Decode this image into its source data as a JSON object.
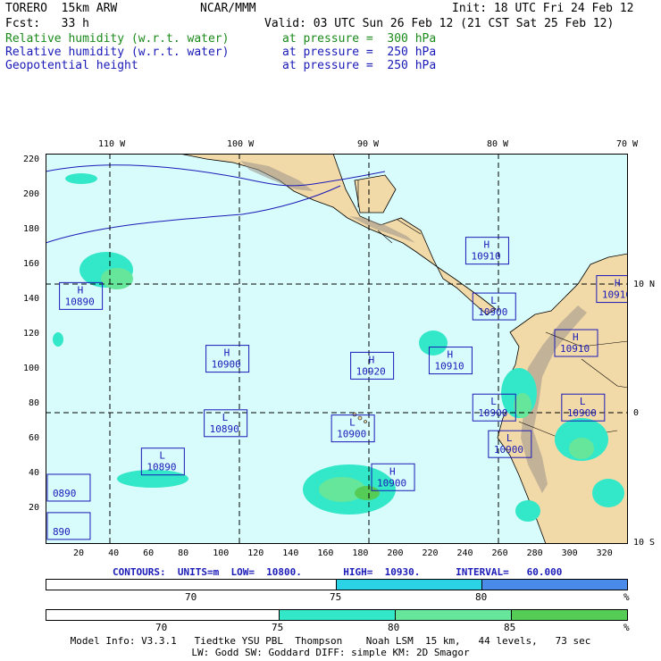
{
  "header": {
    "model": "TORERO  15km ARW",
    "org": "NCAR/MMM",
    "init": "Init: 18 UTC Fri 24 Feb 12",
    "fcst": "Fcst:   33 h",
    "valid": "Valid: 03 UTC Sun 26 Feb 12 (21 CST Sat 25 Feb 12)",
    "fields": [
      {
        "name": "Relative humidity (w.r.t. water)",
        "level": "at pressure =  300 hPa",
        "color": "#1a8a1a"
      },
      {
        "name": "Relative humidity (w.r.t. water)",
        "level": "at pressure =  250 hPa",
        "color": "#1a1ab8"
      },
      {
        "name": "Geopotential height",
        "level": "at pressure =  250 hPa",
        "color": "#1a1ab8"
      }
    ]
  },
  "map": {
    "lon_labels": [
      "110 W",
      "100 W",
      "90 W",
      "80 W",
      "70 W"
    ],
    "lat_labels": [
      "10 N",
      "0",
      "10 S"
    ],
    "x_ticks": [
      "20",
      "40",
      "60",
      "80",
      "100",
      "120",
      "140",
      "160",
      "180",
      "200",
      "220",
      "240",
      "260",
      "280",
      "300",
      "320"
    ],
    "y_ticks": [
      "220",
      "200",
      "180",
      "160",
      "140",
      "120",
      "100",
      "80",
      "60",
      "40",
      "20"
    ],
    "ocean_color": "#d8fbfb",
    "land_color": "#f2d9a8",
    "highs_lows": [
      {
        "type": "H",
        "value": "10910",
        "x": 241,
        "y": 176
      },
      {
        "type": "H",
        "value": "10890",
        "x": 8,
        "y": 150
      },
      {
        "type": "L",
        "value": "10900",
        "x": 245,
        "y": 144
      },
      {
        "type": "H",
        "value": "10910",
        "x": 316,
        "y": 154
      },
      {
        "type": "H",
        "value": "10910",
        "x": 292,
        "y": 123
      },
      {
        "type": "H",
        "value": "10900",
        "x": 92,
        "y": 114
      },
      {
        "type": "H",
        "value": "10920",
        "x": 175,
        "y": 110
      },
      {
        "type": "H",
        "value": "10910",
        "x": 220,
        "y": 113
      },
      {
        "type": "L",
        "value": "10900",
        "x": 245,
        "y": 86
      },
      {
        "type": "L",
        "value": "10900",
        "x": 296,
        "y": 86
      },
      {
        "type": "L",
        "value": "10890",
        "x": 91,
        "y": 77
      },
      {
        "type": "L",
        "value": "10900",
        "x": 164,
        "y": 74
      },
      {
        "type": "L",
        "value": "10900",
        "x": 254,
        "y": 65
      },
      {
        "type": "L",
        "value": "10890",
        "x": 55,
        "y": 55
      },
      {
        "type": "H",
        "value": "10900",
        "x": 187,
        "y": 46
      },
      {
        "type": "",
        "value": "0890",
        "x": 1,
        "y": 40
      },
      {
        "type": "",
        "value": "890",
        "x": 1,
        "y": 18
      }
    ]
  },
  "contours": {
    "text": "CONTOURS:  UNITS=m  LOW=  10800.       HIGH=  10930.      INTERVAL=   60.000"
  },
  "colorbar_blue": {
    "labels": [
      "70",
      "75",
      "80",
      "%"
    ],
    "colors": [
      "#ffffff",
      "#2ad4e6",
      "#4a8ae8"
    ]
  },
  "colorbar_green": {
    "labels": [
      "70",
      "75",
      "80",
      "85",
      "%"
    ],
    "colors": [
      "#ffffff",
      "#33e8c8",
      "#66e69a",
      "#55cc55"
    ]
  },
  "footer": {
    "line1": "Model Info: V3.3.1   Tiedtke YSU PBL  Thompson    Noah LSM  15 km,   44 levels,   73 sec",
    "line2": "LW: Godd SW: Goddard DIFF: simple KM: 2D Smagor"
  }
}
